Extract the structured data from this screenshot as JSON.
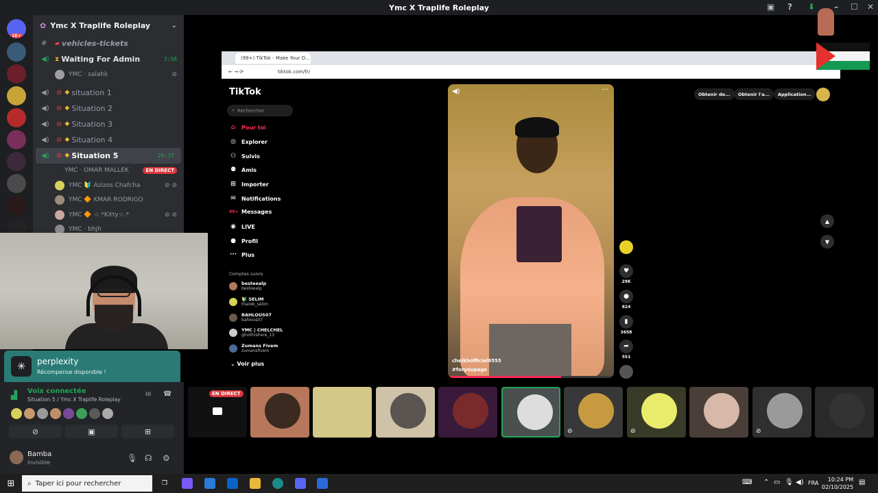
{
  "window": {
    "title": "Ymc X Traplife Roleplay"
  },
  "servers": {
    "badge": "1K+"
  },
  "guild": {
    "name": "Ymc X Traplife Roleplay"
  },
  "channels": [
    {
      "name": "vehicles-tickets"
    },
    {
      "name": "Waiting For Admin",
      "timer": "3:58"
    },
    {
      "name": "situation 1"
    },
    {
      "name": "Situation 2"
    },
    {
      "name": "Situation 3"
    },
    {
      "name": "Situation 4"
    },
    {
      "name": "Situation 5",
      "timer": "26:37"
    }
  ],
  "members": {
    "waiting": {
      "name": "YMC · salahk"
    },
    "sit5": [
      {
        "name": "YMC · OMAR MALLEK",
        "badge": "EN DIRECT"
      },
      {
        "name": "YMC 🔰 Azizos Chafcha"
      },
      {
        "name": "YMC 🔶 KMAR RODRIGO"
      },
      {
        "name": "YMC 🔶 ☆.*Kitty☆.*"
      },
      {
        "name": "YMC · bhjh"
      }
    ]
  },
  "perplexity": {
    "title": "perplexity",
    "subtitle": "Récompense disponible !"
  },
  "voice": {
    "title": "Voix connectée",
    "subtitle": "Situation 5 / Ymc X Traplife Roleplay"
  },
  "user": {
    "name": "Bamba",
    "status": "Invisible"
  },
  "browser": {
    "tab_title": "(99+) TikTok - Make Your D...",
    "url": "tiktok.com/fr/"
  },
  "tiktok": {
    "logo": "TikTok",
    "search_placeholder": "Rechercher",
    "nav": [
      "Pour toi",
      "Explorer",
      "Suivis",
      "Amis",
      "Importer",
      "Notifications",
      "Messages",
      "LIVE",
      "Profil",
      "Plus"
    ],
    "messages_badge": "99+",
    "following_title": "Comptes suivis",
    "following": [
      {
        "name": "besteealp",
        "user": "besteealp"
      },
      {
        "name": "🔰 SELIM",
        "user": "thareb_selim"
      },
      {
        "name": "BAHLOUS07",
        "user": "bahlous07"
      },
      {
        "name": "YMC | CHELCHEL",
        "user": "ghvithishere_13"
      },
      {
        "name": "Zumans Fivem",
        "user": "zumansfivem"
      }
    ],
    "see_more": "Voir plus",
    "top_actions": [
      "Obtenir de...",
      "Obtenir l'a...",
      "Application..."
    ],
    "video": {
      "author": "cheikhofficiel6555",
      "hashtag": "#foryoupage",
      "progress": 0.68
    },
    "counts": {
      "likes": "29K",
      "comments": "824",
      "saves": "3658",
      "shares": "551"
    }
  },
  "streams": {
    "live_label": "EN DIRECT"
  },
  "taskbar": {
    "search": "Taper ici pour rechercher",
    "lang": "FRA",
    "time": "10:24 PM",
    "date": "02/10/2025"
  },
  "colors": {
    "discord_green": "#23a559",
    "tiktok_red": "#fe2c55",
    "live_red": "#da373c",
    "perplexity_teal": "#2a7b76"
  }
}
